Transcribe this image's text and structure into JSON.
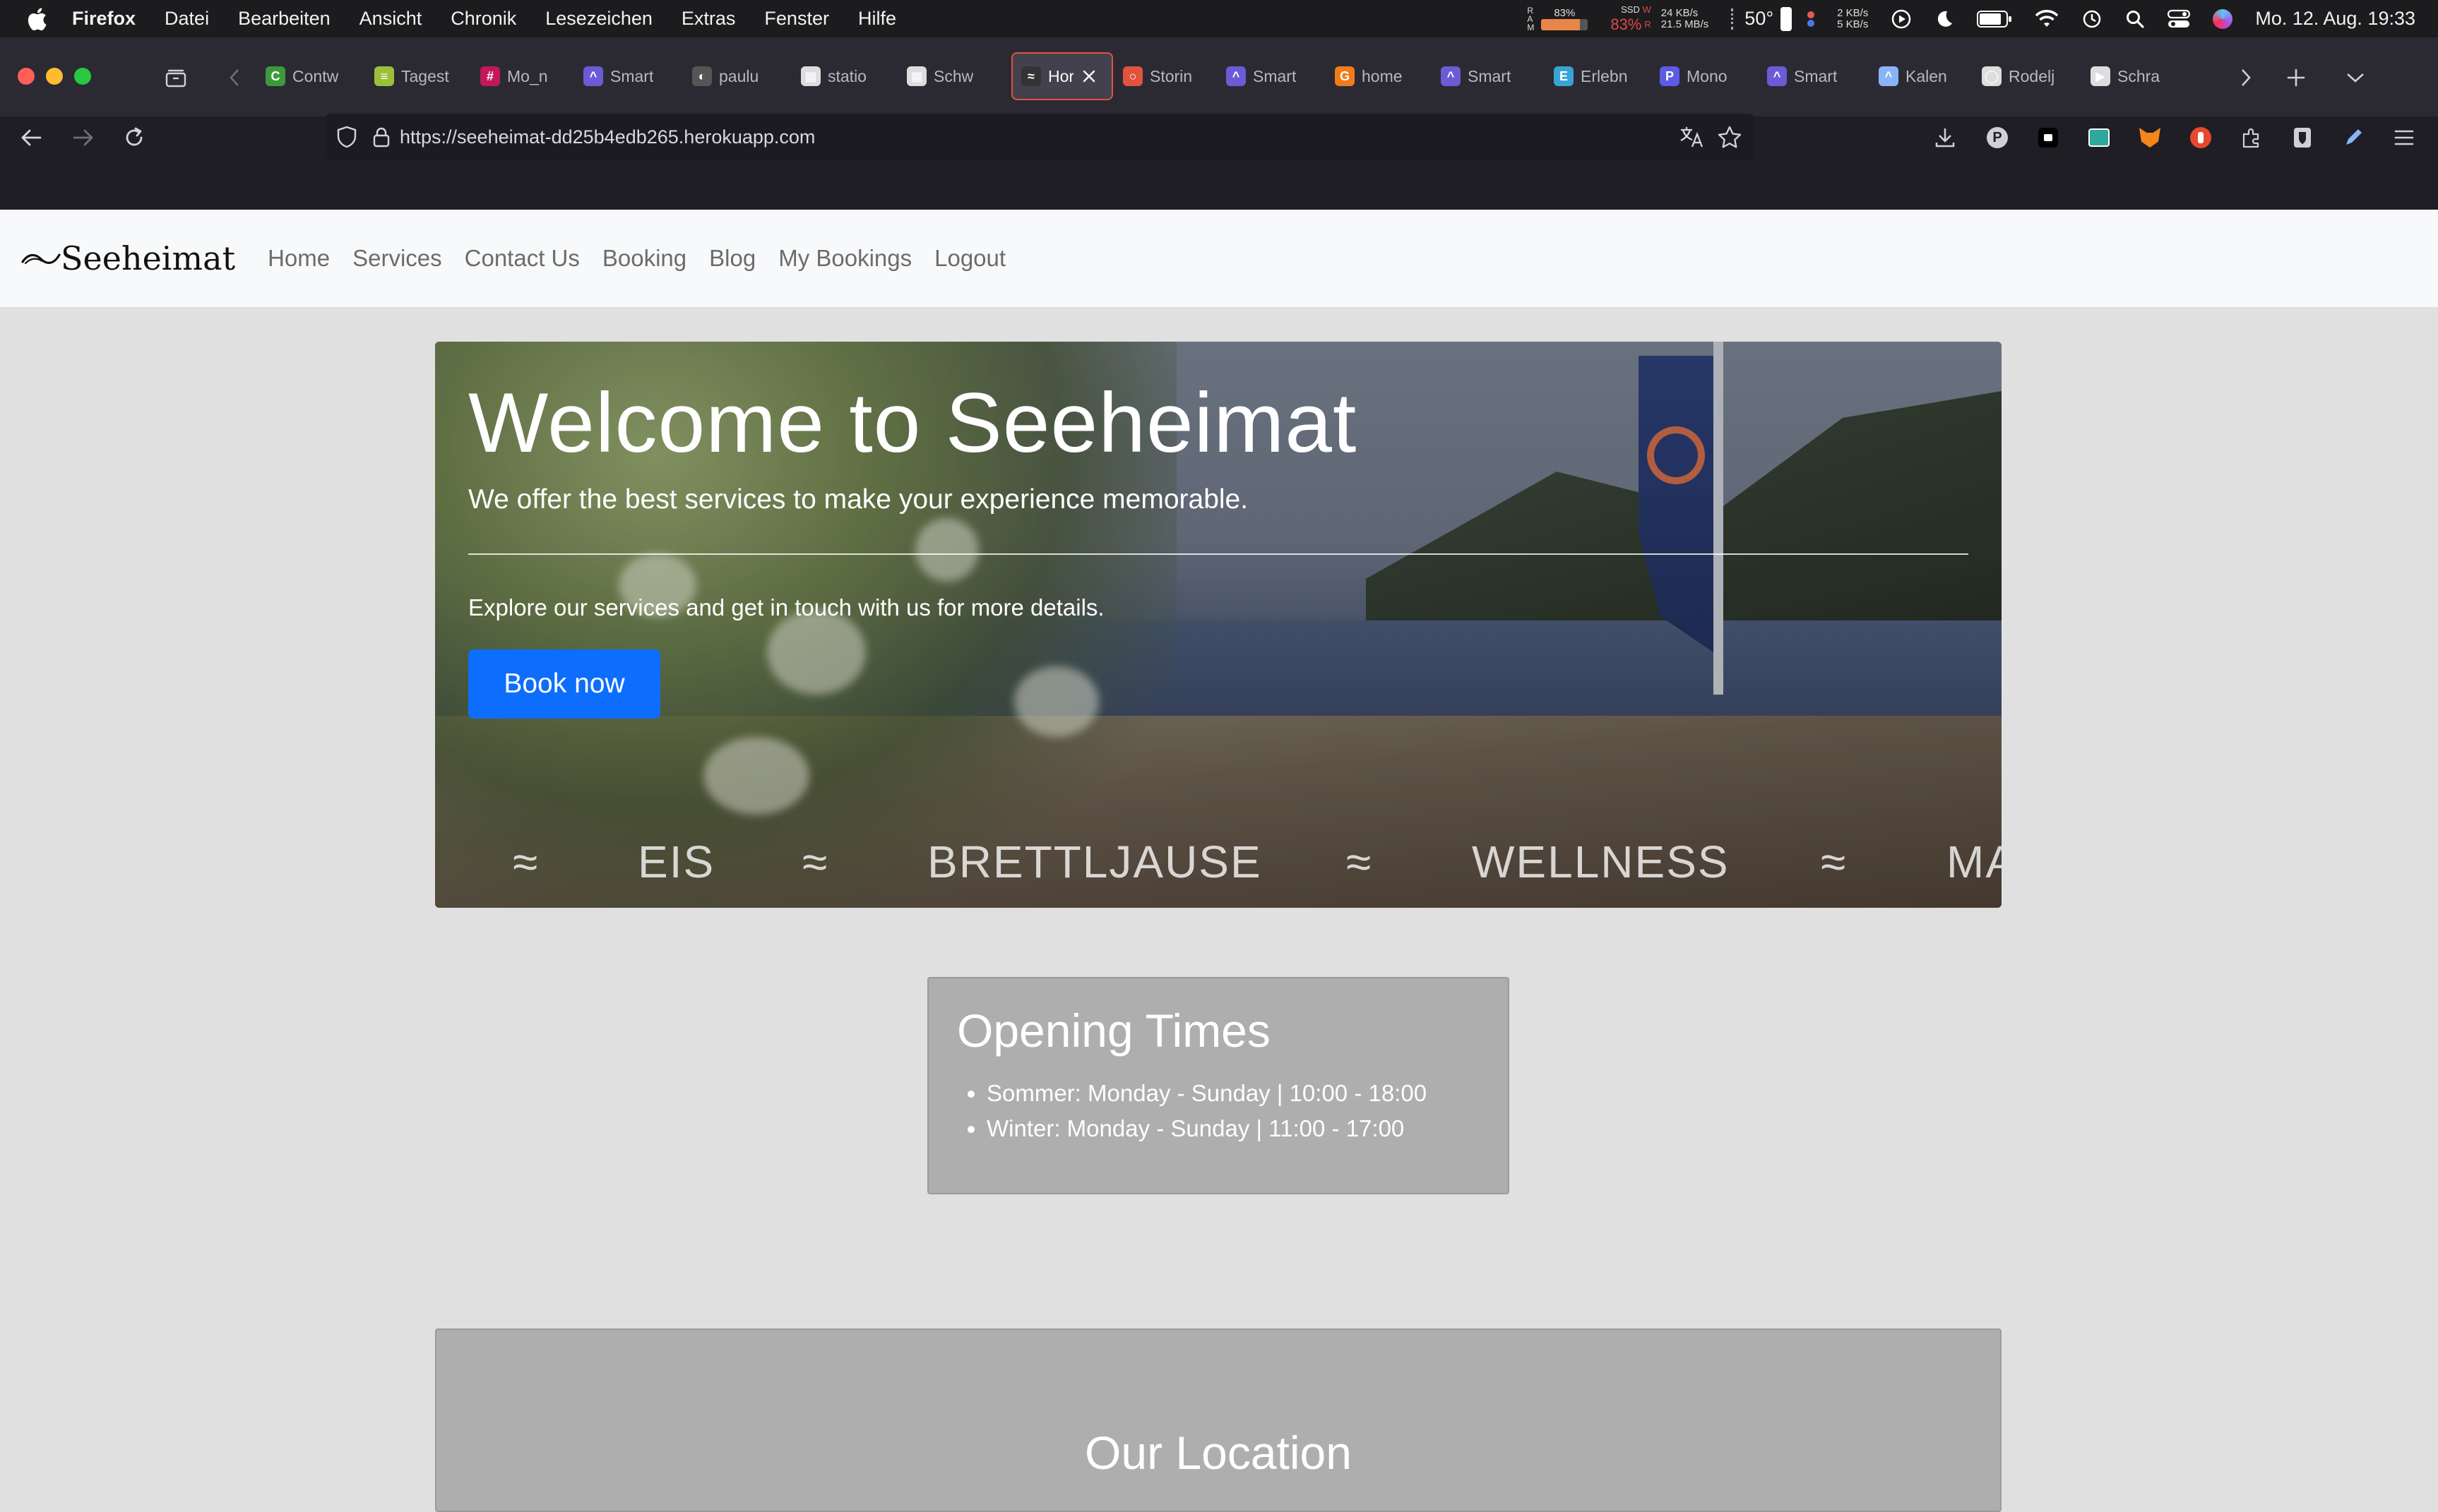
{
  "menubar": {
    "app": "Firefox",
    "menus": [
      "Datei",
      "Bearbeiten",
      "Ansicht",
      "Chronik",
      "Lesezeichen",
      "Extras",
      "Fenster",
      "Hilfe"
    ],
    "ram_label": "R\nA\nM",
    "ram_pct": "83%",
    "ssd_label": "SSD",
    "ssd_w": "W",
    "ssd_r": "R",
    "ssd_pct": "83%",
    "ssd_write": "24 KB/s",
    "ssd_read": "21.5 MB/s",
    "temp": "50°",
    "net_up": "2 KB/s",
    "net_down": "5 KB/s",
    "datetime": "Mo. 12. Aug.  19:33"
  },
  "tabs": [
    {
      "label": "Contw",
      "color": "#3c9a3c",
      "glyph": "C"
    },
    {
      "label": "Tagest",
      "color": "#9bbf3a",
      "glyph": "≡"
    },
    {
      "label": "Mo_n",
      "color": "#c2185b",
      "glyph": "#"
    },
    {
      "label": "Smart",
      "color": "#6b5bd6",
      "glyph": "^"
    },
    {
      "label": "paulu",
      "color": "#555",
      "glyph": "◐"
    },
    {
      "label": "statio",
      "color": "#ddd",
      "glyph": "▦"
    },
    {
      "label": "Schw",
      "color": "#ddd",
      "glyph": "▦"
    },
    {
      "label": "Hor",
      "color": "#333",
      "glyph": "≈"
    },
    {
      "label": "Storin",
      "color": "#e0533d",
      "glyph": "○"
    },
    {
      "label": "Smart",
      "color": "#6b5bd6",
      "glyph": "^"
    },
    {
      "label": "home",
      "color": "#f07b1a",
      "glyph": "G"
    },
    {
      "label": "Smart",
      "color": "#6b5bd6",
      "glyph": "^"
    },
    {
      "label": "Erlebn",
      "color": "#3aa3d6",
      "glyph": "E"
    },
    {
      "label": "Mono",
      "color": "#5b5be6",
      "glyph": "P"
    },
    {
      "label": "Smart",
      "color": "#6b5bd6",
      "glyph": "^"
    },
    {
      "label": "Kalen",
      "color": "#8ab4f8",
      "glyph": "^"
    },
    {
      "label": "Rodelj",
      "color": "#ddd",
      "glyph": "◯"
    },
    {
      "label": "Schra",
      "color": "#ddd",
      "glyph": "▶"
    }
  ],
  "url": "https://seeheimat-dd25b4edb265.herokuapp.com",
  "site": {
    "brand": "Seeheimat",
    "nav": [
      "Home",
      "Services",
      "Contact Us",
      "Booking",
      "Blog",
      "My Bookings",
      "Logout"
    ],
    "hero": {
      "title": "Welcome to Seeheimat",
      "lead": "We offer the best services to make your experience memorable.",
      "explore": "Explore our services and get in touch with us for more details.",
      "button": "Book now",
      "ticker": [
        "≈",
        "EIS",
        "≈",
        "BRETTLJAUSE",
        "≈",
        "WELLNESS",
        "≈",
        "MA"
      ]
    },
    "opening": {
      "title": "Opening Times",
      "items": [
        "Sommer: Monday - Sunday | 10:00 - 18:00",
        "Winter: Monday - Sunday | 11:00 - 17:00"
      ]
    },
    "location": {
      "title": "Our Location"
    }
  }
}
